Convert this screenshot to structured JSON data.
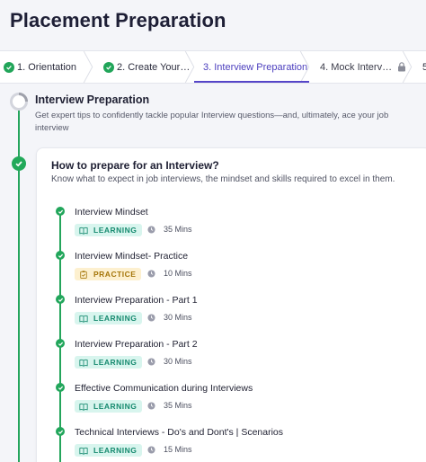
{
  "page": {
    "title": "Placement Preparation"
  },
  "steps": [
    {
      "label": "1. Orientation",
      "state": "completed"
    },
    {
      "label": "2. Create Your…",
      "state": "completed"
    },
    {
      "label": "3. Interview Preparation",
      "state": "active"
    },
    {
      "label": "4. Mock Interv…",
      "state": "locked"
    },
    {
      "label": "5",
      "state": "upcoming"
    }
  ],
  "section": {
    "title": "Interview Preparation",
    "description": "Get expert tips to confidently tackle popular Interview questions—and, ultimately, ace your job interview"
  },
  "module": {
    "title": "How to prepare for an Interview?",
    "subtitle": "Know what to expect in job interviews, the mindset and skills required to excel in them.",
    "items": [
      {
        "title": "Interview Mindset",
        "type": "LEARNING",
        "duration": "35 Mins"
      },
      {
        "title": "Interview Mindset- Practice",
        "type": "PRACTICE",
        "duration": "10 Mins"
      },
      {
        "title": "Interview Preparation - Part 1",
        "type": "LEARNING",
        "duration": "30 Mins"
      },
      {
        "title": "Interview Preparation - Part 2",
        "type": "LEARNING",
        "duration": "30 Mins"
      },
      {
        "title": "Effective Communication during Interviews",
        "type": "LEARNING",
        "duration": "35 Mins"
      },
      {
        "title": "Technical Interviews - Do's and Dont's | Scenarios",
        "type": "LEARNING",
        "duration": "15 Mins"
      }
    ]
  },
  "colors": {
    "accent": "#5545c8",
    "success": "#22a65b",
    "learning_bg": "#d8f5ee",
    "practice_bg": "#fdf0cf"
  },
  "icons": {
    "step_done": "check-circle-icon",
    "locked": "lock-icon",
    "learning": "book-icon",
    "practice": "clipboard-icon",
    "duration": "clock-icon"
  }
}
